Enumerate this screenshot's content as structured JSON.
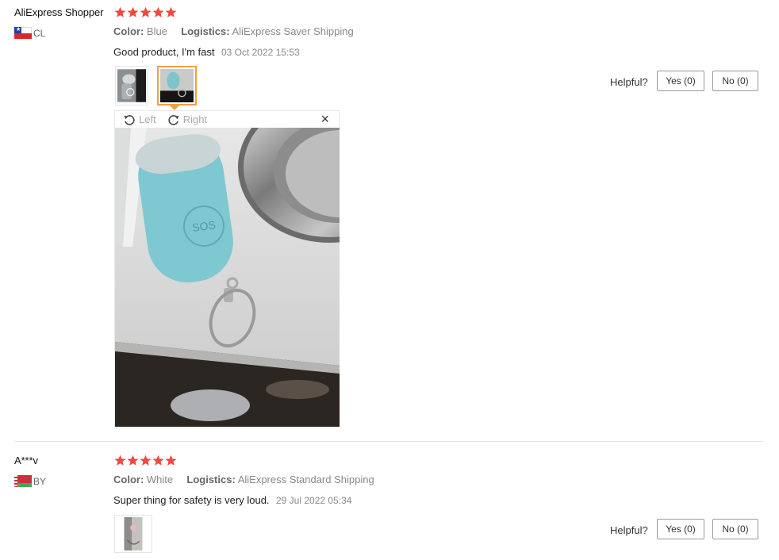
{
  "reviews": [
    {
      "user": "AliExpress Shopper",
      "country_code": "CL",
      "rating": 5,
      "color_label": "Color:",
      "color_value": "Blue",
      "logistics_label": "Logistics:",
      "logistics_value": "AliExpress Saver Shipping",
      "text": "Good product, I'm fast",
      "date": "03 Oct 2022 15:53",
      "thumbnail_count": 2,
      "selected_thumbnail": 2,
      "helpful_label": "Helpful?",
      "yes_label": "Yes (0)",
      "no_label": "No (0)"
    },
    {
      "user": "A***v",
      "country_code": "BY",
      "rating": 5,
      "color_label": "Color:",
      "color_value": "White",
      "logistics_label": "Logistics:",
      "logistics_value": "AliExpress Standard Shipping",
      "text": "Super thing for safety is very loud.",
      "date": "29 Jul 2022 05:34",
      "thumbnail_count": 1,
      "helpful_label": "Helpful?",
      "yes_label": "Yes (0)",
      "no_label": "No (0)"
    }
  ],
  "viewer": {
    "rotate_left_label": "Left",
    "rotate_right_label": "Right",
    "close_glyph": "×",
    "image_text": "SOS"
  },
  "icons": {
    "star": "star-icon",
    "rotate_left": "rotate-left-icon",
    "rotate_right": "rotate-right-icon",
    "close": "close-icon"
  },
  "colors": {
    "star": "#f0483e",
    "active_thumb_border": "#f0a040",
    "divider": "#e5e5e5"
  }
}
